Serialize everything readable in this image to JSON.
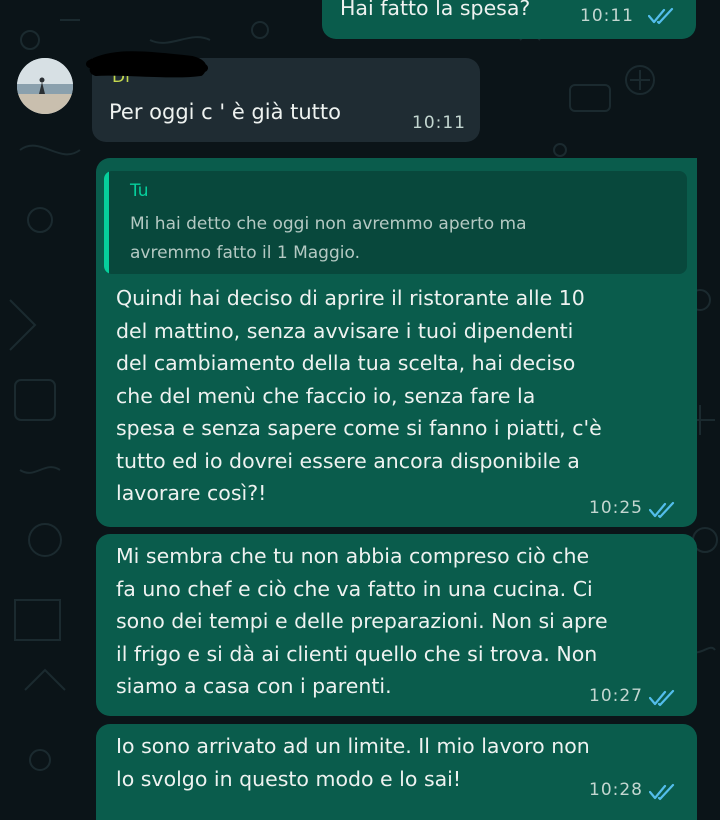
{
  "chat": {
    "messages": [
      {
        "direction": "outgoing",
        "text": "Hai fatto la spesa?",
        "time": "10:11",
        "status": "read"
      },
      {
        "direction": "incoming",
        "sender": "Di",
        "text": "Per oggi c ' è già tutto",
        "time": "10:11"
      },
      {
        "direction": "outgoing",
        "quote": {
          "author": "Tu",
          "text": "Mi hai detto che oggi non avremmo aperto ma\navremmo fatto il 1 Maggio."
        },
        "text": "Quindi hai deciso di aprire il ristorante alle 10\ndel mattino, senza avvisare i tuoi dipendenti\ndel cambiamento della tua scelta, hai deciso\nche del menù che faccio io, senza fare la\nspesa e senza sapere come si fanno i piatti, c'è\ntutto ed io dovrei essere ancora disponibile a\nlavorare così?!",
        "time": "10:25",
        "status": "read"
      },
      {
        "direction": "outgoing",
        "text": "Mi sembra che tu non abbia compreso ciò che\nfa uno chef e ciò che va fatto in una cucina. Ci\nsono dei tempi e delle preparazioni. Non si apre\nil frigo e si dà ai clienti quello che si trova. Non\nsiamo a casa con i parenti.",
        "time": "10:27",
        "status": "read"
      },
      {
        "direction": "outgoing",
        "text": "Io sono arrivato ad un limite. Il mio lavoro non\nlo svolgo in questo modo e lo sai!",
        "time": "10:28",
        "status": "read"
      }
    ]
  },
  "colors": {
    "background": "#0b1418",
    "outgoing_bubble": "#0a5c4c",
    "incoming_bubble": "#1f2c33",
    "quote_box": "#08483c",
    "quote_bar": "#06cf9c",
    "read_ticks": "#53bdeb",
    "sender_name": "#c5d94f"
  },
  "icons": {
    "read_receipt": "double-check-icon",
    "avatar": "beach-avatar",
    "name_redaction": "scribble-redaction"
  }
}
